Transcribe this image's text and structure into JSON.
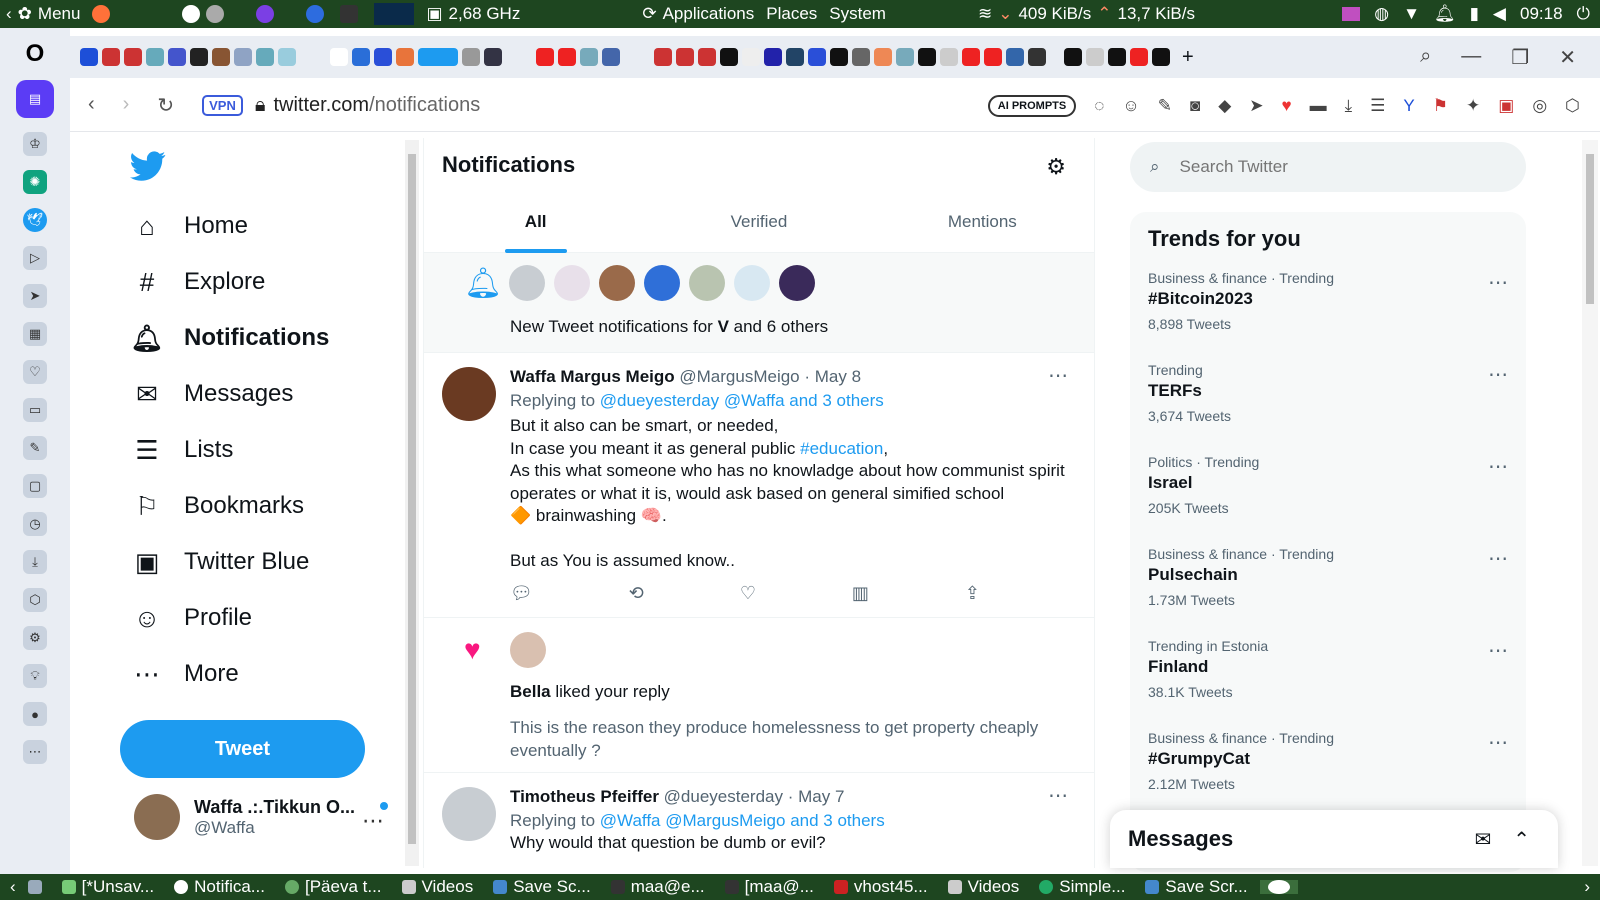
{
  "system_bar": {
    "menu": "Menu",
    "cpu": "2,68 GHz",
    "applications": "Applications",
    "places": "Places",
    "system": "System",
    "down_speed": "409 KiB/s",
    "up_speed": "13,7 KiB/s",
    "clock": "09:18"
  },
  "browser": {
    "vpn": "VPN",
    "url_domain": "twitter.com",
    "url_path": "/notifications",
    "ai_prompts": "AI PROMPTS"
  },
  "nav": {
    "items": [
      {
        "label": "Home",
        "icon": "home-icon"
      },
      {
        "label": "Explore",
        "icon": "hashtag-icon"
      },
      {
        "label": "Notifications",
        "icon": "bell-icon"
      },
      {
        "label": "Messages",
        "icon": "envelope-icon"
      },
      {
        "label": "Lists",
        "icon": "list-icon"
      },
      {
        "label": "Bookmarks",
        "icon": "bookmark-icon"
      },
      {
        "label": "Twitter Blue",
        "icon": "twitter-blue-icon"
      },
      {
        "label": "Profile",
        "icon": "profile-icon"
      },
      {
        "label": "More",
        "icon": "more-circle-icon"
      }
    ],
    "tweet_button": "Tweet"
  },
  "account": {
    "name": "Waffa .:.Tikkun O...",
    "handle": "@Waffa"
  },
  "main": {
    "title": "Notifications",
    "tabs": [
      "All",
      "Verified",
      "Mentions"
    ],
    "new_tweets": {
      "prefix": "New Tweet notifications for ",
      "bold": "V",
      "suffix": " and 6 others"
    },
    "tweet1": {
      "name": "Waffa Margus Meigo",
      "handle": "@MargusMeigo",
      "date": "· May 8",
      "replying_to": "Replying to ",
      "reply_links": "@dueyesterday @Waffa and 3 others",
      "line1": "But it also can be smart, or needed,",
      "line2_pre": "In case you meant it as general public ",
      "line2_link": "#education",
      "line2_post": ",",
      "line3": "As this what someone who has no knowladge about how communist spirit operates or what it is, would ask based on general simified school",
      "line4": "🔶 brainwashing 🧠.",
      "line5": "But as You is assumed know.."
    },
    "like": {
      "who": "Bella",
      "action": " liked your reply",
      "quote": "This is the reason they produce homelessness to get property cheaply eventually ?"
    },
    "tweet2": {
      "name": "Timotheus Pfeiffer",
      "handle": "@dueyesterday",
      "date": "· May 7",
      "replying_to": "Replying to ",
      "reply_links": "@Waffa @MargusMeigo and 3 others",
      "body": "Why would that question be dumb or evil?"
    }
  },
  "right": {
    "search_placeholder": "Search Twitter",
    "trends_title": "Trends for you",
    "trends": [
      {
        "context": "Business & finance · Trending",
        "name": "#Bitcoin2023",
        "count": "8,898 Tweets"
      },
      {
        "context": "Trending",
        "name": "TERFs",
        "count": "3,674 Tweets"
      },
      {
        "context": "Politics · Trending",
        "name": "Israel",
        "count": "205K Tweets"
      },
      {
        "context": "Business & finance · Trending",
        "name": "Pulsechain",
        "count": "1.73M Tweets"
      },
      {
        "context": "Trending in Estonia",
        "name": "Finland",
        "count": "38.1K Tweets"
      },
      {
        "context": "Business & finance · Trending",
        "name": "#GrumpyCat",
        "count": "2.12M Tweets"
      }
    ],
    "messages_title": "Messages"
  },
  "taskbar": {
    "items": [
      "[*Unsav...",
      "Notifica...",
      "[Päeva t...",
      "Videos",
      "Save Sc...",
      "maa@e...",
      "[maa@...",
      "vhost45...",
      "Videos",
      "Simple...",
      "Save Scr..."
    ]
  },
  "colors": {
    "twitter_blue": "#1d9bf0",
    "like_pink": "#f91880",
    "system_bar": "#1e4620"
  }
}
